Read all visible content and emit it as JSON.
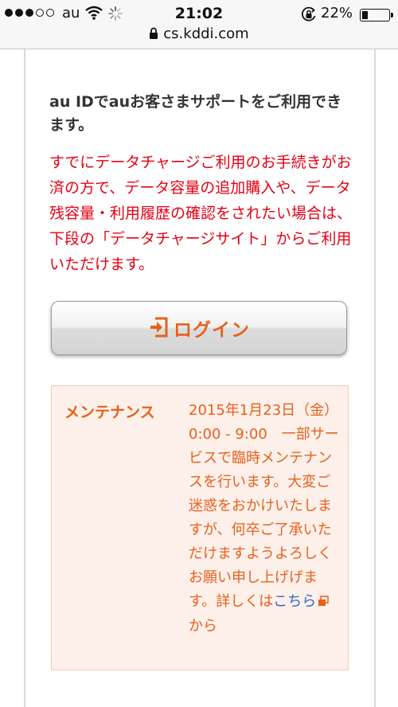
{
  "status_bar": {
    "carrier": "au",
    "time": "21:02",
    "battery_percent": "22%",
    "battery_level": 0.22,
    "signal_bars_filled": 3,
    "signal_bars_total": 5
  },
  "url_bar": {
    "url": "cs.kddi.com"
  },
  "content": {
    "intro": "au IDでauお客さまサポートをご利用できます。",
    "notice": "すでにデータチャージご利用のお手続きがお済の方で、データ容量の追加購入や、データ残容量・利用履歴の確認をされたい場合は、下段の「データチャージサイト」からご利用いただけます。",
    "login_button_label": "ログイン"
  },
  "maintenance": {
    "title": "メンテナンス",
    "text_before_link": "2015年1月23日（金）0:00 - 9:00　一部サービスで臨時メンテナンスを行います。大変ご迷惑をおかけいたしますが、何卒ご了承いただけますようよろしくお願い申し上げげます。詳しくは",
    "link_text": "こちら",
    "text_after_link": "から"
  },
  "colors": {
    "notice_red": "#e60012",
    "accent_orange": "#e8601c",
    "link_blue": "#2f6ec9",
    "maintenance_bg": "#fdf0ea"
  }
}
